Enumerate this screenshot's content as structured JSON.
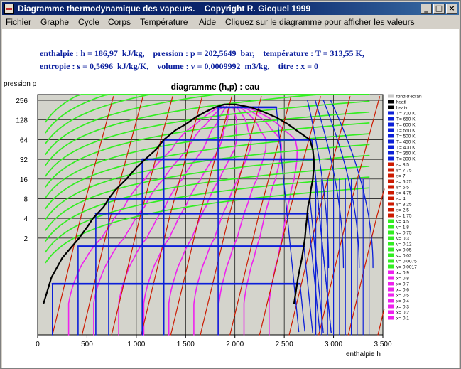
{
  "window": {
    "title": "Diagramme thermodynamique des vapeurs.    Copyright R. Gicquel 1999",
    "buttons": {
      "minimize": "_",
      "maximize": "□",
      "close": "×"
    }
  },
  "menu": [
    "Fichier",
    "Graphe",
    "Cycle",
    "Corps",
    "Température",
    "Aide",
    "Cliquez sur le diagramme pour afficher les valeurs"
  ],
  "readout": {
    "line1": "enthalpie : h = 186,97  kJ/kg,    pression : p = 202,5649  bar,    température : T = 313,55 K,",
    "line2": "entropie : s = 0,5696  kJ/kg/K,    volume : v = 0,0009992  m3/kg,    titre : x = 0"
  },
  "colors": {
    "sat": "#000000",
    "isotherm": "#0b1fd8",
    "isentrope": "#cc1a00",
    "isochore": "#33ee22",
    "quality": "#ee22ee",
    "plot_bg": "#d4d4cc"
  },
  "chart_data": {
    "type": "line",
    "title": "diagramme (h,p) : eau",
    "xlabel": "enthalpie  h",
    "ylabel": "pression  p",
    "xlim": [
      0,
      3500
    ],
    "y_scale": "log2",
    "x_ticks": [
      "0",
      "500",
      "1 000",
      "1 500",
      "2 000",
      "2 500",
      "3 000",
      "3 500"
    ],
    "y_ticks": [
      "256",
      "128",
      "64",
      "32",
      "16",
      "8",
      "4",
      "2"
    ],
    "grid": true,
    "legend_position": "right",
    "legend": [
      {
        "label": "fond d'écran",
        "type": "bg"
      },
      {
        "label": "hsatl",
        "type": "sat"
      },
      {
        "label": "hsatv",
        "type": "sat"
      },
      {
        "label": "T= 700 K",
        "type": "isotherm"
      },
      {
        "label": "T= 650 K",
        "type": "isotherm"
      },
      {
        "label": "T= 600 K",
        "type": "isotherm"
      },
      {
        "label": "T= 550 K",
        "type": "isotherm"
      },
      {
        "label": "T= 500 K",
        "type": "isotherm"
      },
      {
        "label": "T= 450 K",
        "type": "isotherm"
      },
      {
        "label": "T= 400 K",
        "type": "isotherm"
      },
      {
        "label": "T= 350 K",
        "type": "isotherm"
      },
      {
        "label": "T= 300 K",
        "type": "isotherm"
      },
      {
        "label": "s= 8.5",
        "type": "isentrope"
      },
      {
        "label": "s= 7.75",
        "type": "isentrope"
      },
      {
        "label": "s= 7",
        "type": "isentrope"
      },
      {
        "label": "s= 6.25",
        "type": "isentrope"
      },
      {
        "label": "s= 5.5",
        "type": "isentrope"
      },
      {
        "label": "s= 4.75",
        "type": "isentrope"
      },
      {
        "label": "s= 4",
        "type": "isentrope"
      },
      {
        "label": "s= 3.25",
        "type": "isentrope"
      },
      {
        "label": "s= 2.5",
        "type": "isentrope"
      },
      {
        "label": "s= 1.75",
        "type": "isentrope"
      },
      {
        "label": "v= 4.5",
        "type": "isochore"
      },
      {
        "label": "v= 1.8",
        "type": "isochore"
      },
      {
        "label": "v= 0.75",
        "type": "isochore"
      },
      {
        "label": "v= 0.3",
        "type": "isochore"
      },
      {
        "label": "v= 0.12",
        "type": "isochore"
      },
      {
        "label": "v= 0.05",
        "type": "isochore"
      },
      {
        "label": "v= 0.02",
        "type": "isochore"
      },
      {
        "label": "v= 0.0075",
        "type": "isochore"
      },
      {
        "label": "v= 0.0017",
        "type": "isochore"
      },
      {
        "label": "x= 0.9",
        "type": "quality"
      },
      {
        "label": "x= 0.8",
        "type": "quality"
      },
      {
        "label": "x= 0.7",
        "type": "quality"
      },
      {
        "label": "x= 0.6",
        "type": "quality"
      },
      {
        "label": "x= 0.5",
        "type": "quality"
      },
      {
        "label": "x= 0.4",
        "type": "quality"
      },
      {
        "label": "x= 0.3",
        "type": "quality"
      },
      {
        "label": "x= 0.2",
        "type": "quality"
      },
      {
        "label": "x= 0.1",
        "type": "quality"
      }
    ],
    "saturation_dome": {
      "liquid": [
        [
          60,
          0.2
        ],
        [
          140,
          0.5
        ],
        [
          250,
          1
        ],
        [
          420,
          2
        ],
        [
          505,
          3
        ],
        [
          560,
          4
        ],
        [
          670,
          6
        ],
        [
          720,
          8
        ],
        [
          790,
          11
        ],
        [
          900,
          16
        ],
        [
          1000,
          24
        ],
        [
          1090,
          32
        ],
        [
          1200,
          45
        ],
        [
          1280,
          64
        ],
        [
          1400,
          90
        ],
        [
          1500,
          110
        ],
        [
          1600,
          140
        ],
        [
          1700,
          170
        ],
        [
          1800,
          200
        ],
        [
          1890,
          221
        ]
      ],
      "vapour": [
        [
          2010,
          221
        ],
        [
          2160,
          200
        ],
        [
          2290,
          170
        ],
        [
          2420,
          140
        ],
        [
          2540,
          110
        ],
        [
          2620,
          90
        ],
        [
          2760,
          64
        ],
        [
          2790,
          45
        ],
        [
          2800,
          32
        ],
        [
          2800,
          24
        ],
        [
          2790,
          16
        ],
        [
          2770,
          11
        ],
        [
          2760,
          8
        ],
        [
          2740,
          6
        ],
        [
          2730,
          4
        ],
        [
          2720,
          3
        ],
        [
          2710,
          2
        ],
        [
          2680,
          1
        ],
        [
          2640,
          0.5
        ],
        [
          2600,
          0.2
        ]
      ]
    },
    "isobar_plateaus": [
      {
        "p": 200,
        "h": [
          1830,
          2420
        ]
      },
      {
        "p": 64,
        "h": [
          1280,
          2780
        ]
      },
      {
        "p": 32,
        "h": [
          1060,
          2800
        ]
      },
      {
        "p": 8,
        "h": [
          720,
          2760
        ]
      },
      {
        "p": 4.75,
        "h": [
          590,
          2740
        ]
      },
      {
        "p": 1.5,
        "h": [
          410,
          2700
        ]
      },
      {
        "p": 0.4,
        "h": [
          150,
          2660
        ]
      }
    ]
  }
}
